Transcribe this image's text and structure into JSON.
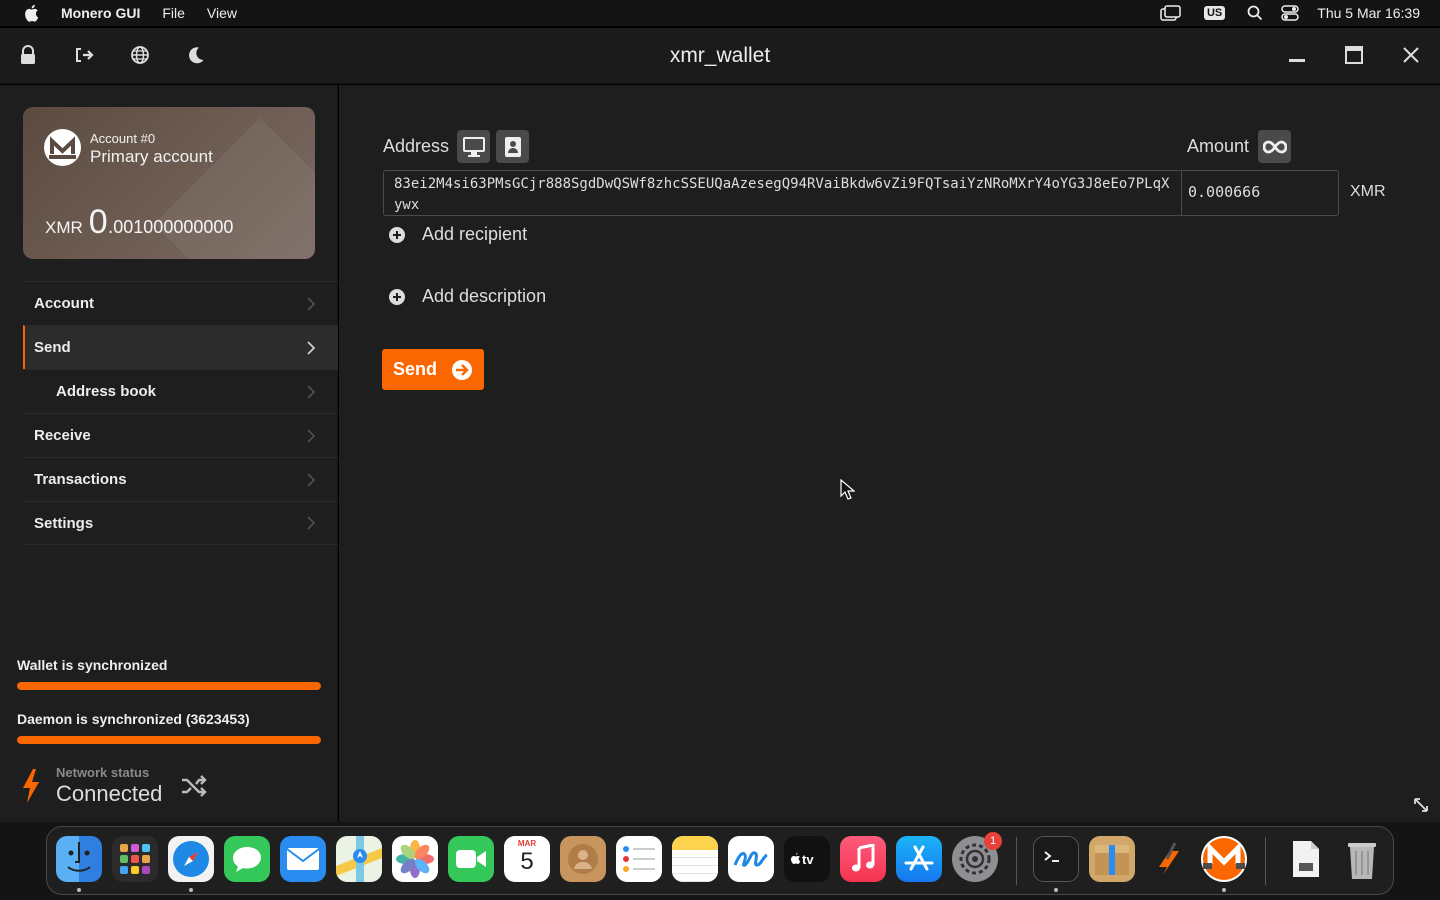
{
  "menubar": {
    "app_name": "Monero GUI",
    "menus": [
      "File",
      "View"
    ],
    "keyboard_layout": "US",
    "datetime": "Thu 5 Mar  16:39"
  },
  "window": {
    "title": "xmr_wallet"
  },
  "account_card": {
    "account_number": "Account #0",
    "account_name": "Primary account",
    "currency": "XMR",
    "balance_int": "0",
    "balance_frac": "001000000000"
  },
  "sidebar": {
    "items": [
      {
        "label": "Account"
      },
      {
        "label": "Send"
      },
      {
        "label": "Address book"
      },
      {
        "label": "Receive"
      },
      {
        "label": "Transactions"
      },
      {
        "label": "Settings"
      }
    ],
    "wallet_sync": "Wallet is synchronized",
    "wallet_sync_progress": 1.0,
    "daemon_sync": "Daemon is synchronized (3623453)",
    "daemon_sync_progress": 1.0,
    "network_status_label": "Network status",
    "network_status_value": "Connected"
  },
  "send_form": {
    "address_label": "Address",
    "amount_label": "Amount",
    "address_value": "83ei2M4si63PMsGCjr888SgdDwQSWf8zhcSSEUQaAzesegQ94RVaiBkdw6vZi9FQTsaiYzNRoMXrY4oYG3J8eEo7PLqXywx",
    "amount_value": "0.000666",
    "amount_unit": "XMR",
    "add_recipient": "Add recipient",
    "add_description": "Add description",
    "send_label": "Send"
  },
  "colors": {
    "accent": "#fa6600",
    "background": "#1e1e1e",
    "titlebar": "#1b1b1b"
  },
  "dock": {
    "apps": [
      "finder-icon",
      "launchpad-icon",
      "safari-icon",
      "messages-icon",
      "mail-icon",
      "maps-icon",
      "photos-icon",
      "facetime-icon",
      "calendar-icon",
      "contacts-icon",
      "reminders-icon",
      "notes-icon",
      "freeform-icon",
      "appletv-icon",
      "music-icon",
      "appstore-icon",
      "system-settings-icon",
      "terminal-icon",
      "archive-utility-icon",
      "shortcut-app-icon",
      "monero-icon",
      "document-icon",
      "trash-icon"
    ],
    "calendar_month": "MAR",
    "calendar_day": "5",
    "settings_badge": "1"
  }
}
